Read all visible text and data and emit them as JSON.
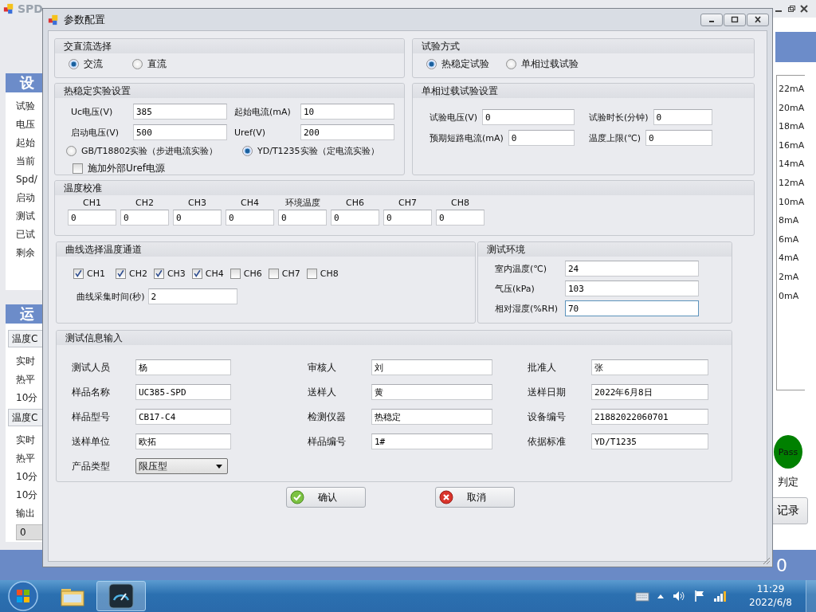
{
  "background_app": {
    "title": "SPD",
    "left_cards": [
      {
        "items": [
          {
            "kind": "header",
            "text": "设"
          },
          {
            "kind": "text",
            "text": "试验"
          },
          {
            "kind": "text",
            "text": "电压"
          },
          {
            "kind": "text",
            "text": "起始"
          },
          {
            "kind": "text",
            "text": "当前"
          },
          {
            "kind": "text",
            "text": "Spd/"
          },
          {
            "kind": "text",
            "text": "启动"
          },
          {
            "kind": "text",
            "text": "测试"
          },
          {
            "kind": "text",
            "text": "已试"
          },
          {
            "kind": "text",
            "text": "剩余"
          }
        ]
      },
      {
        "items": [
          {
            "kind": "header",
            "text": "运"
          },
          {
            "kind": "tab",
            "text": "温度C"
          },
          {
            "kind": "text",
            "text": "实时"
          },
          {
            "kind": "text",
            "text": "热平"
          },
          {
            "kind": "text",
            "text": "10分"
          },
          {
            "kind": "tab",
            "text": "温度C"
          },
          {
            "kind": "text",
            "text": "实时"
          },
          {
            "kind": "text",
            "text": "热平"
          },
          {
            "kind": "text",
            "text": "10分"
          },
          {
            "kind": "text",
            "text": "10分"
          },
          {
            "kind": "text",
            "text": "输出"
          },
          {
            "kind": "field",
            "text": "0"
          }
        ]
      }
    ],
    "axis_labels": [
      "22mA",
      "20mA",
      "18mA",
      "16mA",
      "14mA",
      "12mA",
      "10mA",
      "8mA",
      "6mA",
      "4mA",
      "2mA",
      "0mA"
    ],
    "status": "Pass",
    "judge_label": "判定",
    "record_button": "记录",
    "footer_text": "0"
  },
  "dialog": {
    "title": "参数配置",
    "current_type": {
      "title": "交直流选择",
      "options": [
        {
          "label": "交流",
          "selected": true
        },
        {
          "label": "直流",
          "selected": false
        }
      ]
    },
    "test_mode": {
      "title": "试验方式",
      "options": [
        {
          "label": "热稳定试验",
          "selected": true
        },
        {
          "label": "单相过载试验",
          "selected": false
        }
      ]
    },
    "thermal": {
      "title": "热稳定实验设置",
      "fields": [
        {
          "label": "Uc电压(V)",
          "value": "385"
        },
        {
          "label": "起始电流(mA)",
          "value": "10"
        },
        {
          "label": "启动电压(V)",
          "value": "500"
        },
        {
          "label": "Uref(V)",
          "value": "200"
        }
      ],
      "standards": [
        {
          "label": "GB/T18802实验（步进电流实验）",
          "selected": false
        },
        {
          "label": "YD/T1235实验（定电流实验）",
          "selected": true
        }
      ],
      "external_uref": {
        "label": "施加外部Uref电源",
        "checked": false
      }
    },
    "overload": {
      "title": "单相过载试验设置",
      "fields": [
        {
          "label": "试验电压(V)",
          "value": "0"
        },
        {
          "label": "试验时长(分钟)",
          "value": "0"
        },
        {
          "label": "预期短路电流(mA)",
          "value": "0"
        },
        {
          "label": "温度上限(℃)",
          "value": "0"
        }
      ]
    },
    "calibration": {
      "title": "温度校准",
      "channels": [
        {
          "label": "CH1",
          "value": "0"
        },
        {
          "label": "CH2",
          "value": "0"
        },
        {
          "label": "CH3",
          "value": "0"
        },
        {
          "label": "CH4",
          "value": "0"
        },
        {
          "label": "环境温度",
          "value": "0"
        },
        {
          "label": "CH6",
          "value": "0"
        },
        {
          "label": "CH7",
          "value": "0"
        },
        {
          "label": "CH8",
          "value": "0"
        }
      ]
    },
    "curve": {
      "title": "曲线选择温度通道",
      "channels": [
        {
          "label": "CH1",
          "checked": true
        },
        {
          "label": "CH2",
          "checked": true
        },
        {
          "label": "CH3",
          "checked": true
        },
        {
          "label": "CH4",
          "checked": true
        },
        {
          "label": "CH6",
          "checked": false
        },
        {
          "label": "CH7",
          "checked": false
        },
        {
          "label": "CH8",
          "checked": false
        }
      ],
      "interval": {
        "label": "曲线采集时间(秒)",
        "value": "2"
      }
    },
    "environment": {
      "title": "测试环境",
      "fields": [
        {
          "label": "室内温度(℃)",
          "value": "24",
          "focused": false
        },
        {
          "label": "气压(kPa)",
          "value": "103",
          "focused": false
        },
        {
          "label": "相对湿度(%RH)",
          "value": "70",
          "focused": true
        }
      ]
    },
    "info": {
      "title": "测试信息输入",
      "fields": [
        {
          "label": "测试人员",
          "value": "杨",
          "kind": "text"
        },
        {
          "label": "审核人",
          "value": "刘",
          "kind": "text"
        },
        {
          "label": "批准人",
          "value": "张",
          "kind": "text"
        },
        {
          "label": "样品名称",
          "value": "UC385-SPD",
          "kind": "text"
        },
        {
          "label": "送样人",
          "value": "黄",
          "kind": "text"
        },
        {
          "label": "送样日期",
          "value": "2022年6月8日",
          "kind": "text"
        },
        {
          "label": "样品型号",
          "value": "CB17-C4",
          "kind": "text"
        },
        {
          "label": "检测仪器",
          "value": "热稳定",
          "kind": "text"
        },
        {
          "label": "设备编号",
          "value": "21882022060701",
          "kind": "text"
        },
        {
          "label": "送样单位",
          "value": "欧拓",
          "kind": "text"
        },
        {
          "label": "样品编号",
          "value": "1#",
          "kind": "text"
        },
        {
          "label": "依据标准",
          "value": "YD/T1235",
          "kind": "text"
        },
        {
          "label": "产品类型",
          "value": "限压型",
          "kind": "dropdown"
        }
      ]
    },
    "buttons": [
      {
        "label": "确认",
        "kind": "confirm"
      },
      {
        "label": "取消",
        "kind": "cancel"
      }
    ]
  },
  "taskbar": {
    "time": "11:29",
    "date": "2022/6/8"
  }
}
